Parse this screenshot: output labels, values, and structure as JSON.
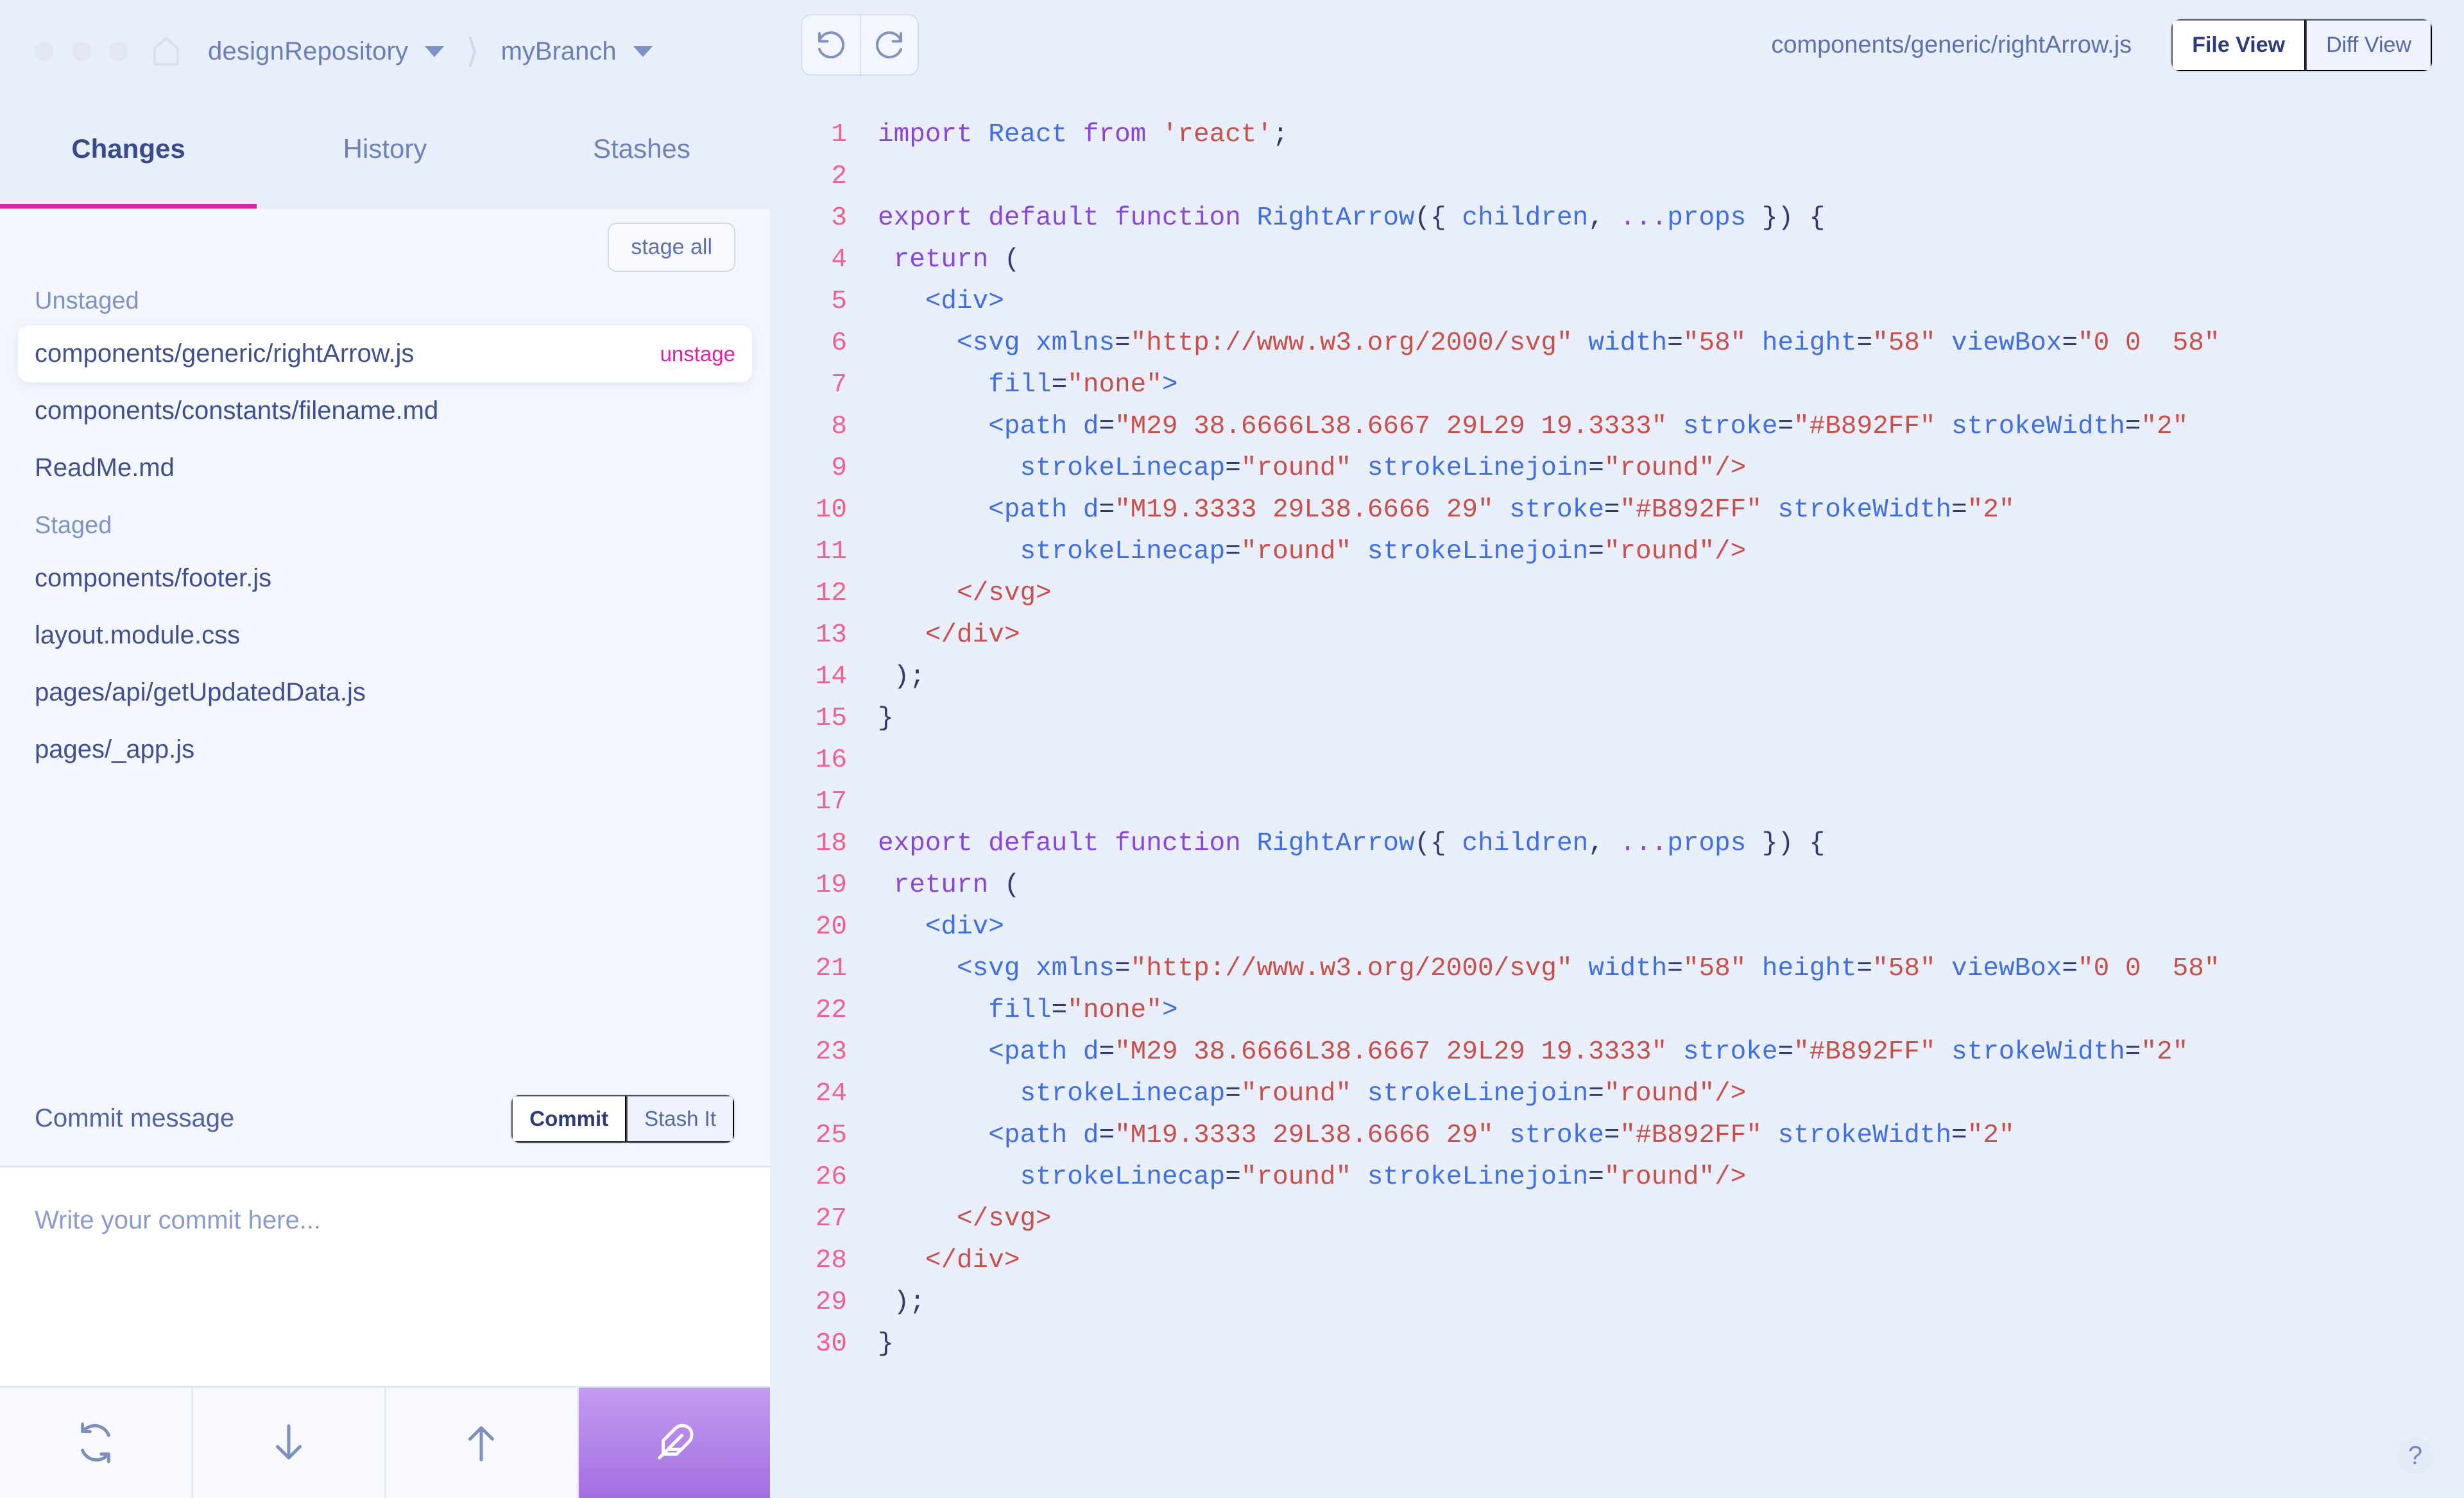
{
  "titlebar": {
    "home_icon": "home-icon",
    "repository": "designRepository",
    "branch": "myBranch",
    "separator": "⟩"
  },
  "tabs": [
    {
      "label": "Changes",
      "active": true
    },
    {
      "label": "History",
      "active": false
    },
    {
      "label": "Stashes",
      "active": false
    }
  ],
  "staging": {
    "stage_all_label": "stage all",
    "unstaged_label": "Unstaged",
    "staged_label": "Staged",
    "unstaged_files": [
      {
        "path": "components/generic/rightArrow.js",
        "action": "unstage",
        "selected": true
      },
      {
        "path": "components/constants/filename.md",
        "action": "",
        "selected": false
      },
      {
        "path": "ReadMe.md",
        "action": "",
        "selected": false
      }
    ],
    "staged_files": [
      {
        "path": "components/footer.js",
        "action": "",
        "selected": false
      },
      {
        "path": "layout.module.css",
        "action": "",
        "selected": false
      },
      {
        "path": "pages/api/getUpdatedData.js",
        "action": "",
        "selected": false
      },
      {
        "path": " pages/_app.js",
        "action": "",
        "selected": false
      }
    ]
  },
  "commit": {
    "header_label": "Commit message",
    "commit_button": "Commit",
    "stash_button": "Stash It",
    "placeholder": "Write your commit here..."
  },
  "bottom_toolbar": [
    {
      "icon": "sync-icon",
      "accent": false
    },
    {
      "icon": "arrow-down-icon",
      "accent": false
    },
    {
      "icon": "arrow-up-icon",
      "accent": false
    },
    {
      "icon": "feather-icon",
      "accent": true
    }
  ],
  "editor": {
    "undo_icon": "undo-icon",
    "redo_icon": "redo-icon",
    "current_file": "components/generic/rightArrow.js",
    "file_view_label": "File View",
    "diff_view_label": "Diff View",
    "active_view": "File View",
    "help_label": "?"
  },
  "colors": {
    "accent_magenta": "#e11fa8",
    "accent_purple": "#a36fe0",
    "line_number": "#f0618f",
    "keyword": "#8b46d6",
    "identifier": "#3f6fe0",
    "string": "#c9504a",
    "code_bg": "#e8eefa",
    "sidebar_bg": "#f4f6fe"
  },
  "code": [
    {
      "n": "1",
      "tokens": [
        {
          "t": "k",
          "v": "import"
        },
        {
          "t": "ctext",
          "v": " "
        },
        {
          "t": "fn",
          "v": "React"
        },
        {
          "t": "ctext",
          "v": " "
        },
        {
          "t": "k",
          "v": "from"
        },
        {
          "t": "ctext",
          "v": " "
        },
        {
          "t": "s",
          "v": "'react'"
        },
        {
          "t": "p",
          "v": ";"
        }
      ]
    },
    {
      "n": "2",
      "tokens": []
    },
    {
      "n": "3",
      "tokens": [
        {
          "t": "k",
          "v": "export default function "
        },
        {
          "t": "fn",
          "v": "RightArrow"
        },
        {
          "t": "p",
          "v": "({ "
        },
        {
          "t": "fn",
          "v": "children"
        },
        {
          "t": "p",
          "v": ", "
        },
        {
          "t": "k",
          "v": "..."
        },
        {
          "t": "fn",
          "v": "props"
        },
        {
          "t": "p",
          "v": " }) {"
        }
      ]
    },
    {
      "n": "4",
      "tokens": [
        {
          "t": "ctext",
          "v": " "
        },
        {
          "t": "k",
          "v": "return"
        },
        {
          "t": "p",
          "v": " ("
        }
      ]
    },
    {
      "n": "5",
      "tokens": [
        {
          "t": "ctext",
          "v": "   "
        },
        {
          "t": "tg",
          "v": "<div>"
        }
      ]
    },
    {
      "n": "6",
      "tokens": [
        {
          "t": "ctext",
          "v": "     "
        },
        {
          "t": "tg",
          "v": "<svg "
        },
        {
          "t": "fn",
          "v": "xmlns"
        },
        {
          "t": "p",
          "v": "="
        },
        {
          "t": "s",
          "v": "\"http://www.w3.org/2000/svg\""
        },
        {
          "t": "ctext",
          "v": " "
        },
        {
          "t": "fn",
          "v": "width"
        },
        {
          "t": "p",
          "v": "="
        },
        {
          "t": "s",
          "v": "\"58\""
        },
        {
          "t": "ctext",
          "v": " "
        },
        {
          "t": "fn",
          "v": "height"
        },
        {
          "t": "p",
          "v": "="
        },
        {
          "t": "s",
          "v": "\"58\""
        },
        {
          "t": "ctext",
          "v": " "
        },
        {
          "t": "fn",
          "v": "viewBox"
        },
        {
          "t": "p",
          "v": "="
        },
        {
          "t": "s",
          "v": "\"0 0  58\""
        }
      ]
    },
    {
      "n": "7",
      "tokens": [
        {
          "t": "ctext",
          "v": "       "
        },
        {
          "t": "fn",
          "v": "fill"
        },
        {
          "t": "p",
          "v": "="
        },
        {
          "t": "s",
          "v": "\"none\""
        },
        {
          "t": "tg",
          "v": ">"
        }
      ]
    },
    {
      "n": "8",
      "tokens": [
        {
          "t": "ctext",
          "v": "       "
        },
        {
          "t": "tg",
          "v": "<path "
        },
        {
          "t": "fn",
          "v": "d"
        },
        {
          "t": "p",
          "v": "="
        },
        {
          "t": "s",
          "v": "\"M29 38.6666L38.6667 29L29 19.3333\""
        },
        {
          "t": "ctext",
          "v": " "
        },
        {
          "t": "fn",
          "v": "stroke"
        },
        {
          "t": "p",
          "v": "="
        },
        {
          "t": "s",
          "v": "\"#B892FF\""
        },
        {
          "t": "ctext",
          "v": " "
        },
        {
          "t": "fn",
          "v": "strokeWidth"
        },
        {
          "t": "p",
          "v": "="
        },
        {
          "t": "s",
          "v": "\"2\""
        }
      ]
    },
    {
      "n": "9",
      "tokens": [
        {
          "t": "ctext",
          "v": "         "
        },
        {
          "t": "fn",
          "v": "strokeLinecap"
        },
        {
          "t": "p",
          "v": "="
        },
        {
          "t": "s",
          "v": "\"round\""
        },
        {
          "t": "ctext",
          "v": " "
        },
        {
          "t": "fn",
          "v": "strokeLinejoin"
        },
        {
          "t": "p",
          "v": "="
        },
        {
          "t": "s",
          "v": "\"round\""
        },
        {
          "t": "cl",
          "v": "/>"
        }
      ]
    },
    {
      "n": "10",
      "tokens": [
        {
          "t": "ctext",
          "v": "       "
        },
        {
          "t": "tg",
          "v": "<path "
        },
        {
          "t": "fn",
          "v": "d"
        },
        {
          "t": "p",
          "v": "="
        },
        {
          "t": "s",
          "v": "\"M19.3333 29L38.6666 29\""
        },
        {
          "t": "ctext",
          "v": " "
        },
        {
          "t": "fn",
          "v": "stroke"
        },
        {
          "t": "p",
          "v": "="
        },
        {
          "t": "s",
          "v": "\"#B892FF\""
        },
        {
          "t": "ctext",
          "v": " "
        },
        {
          "t": "fn",
          "v": "strokeWidth"
        },
        {
          "t": "p",
          "v": "="
        },
        {
          "t": "s",
          "v": "\"2\""
        }
      ]
    },
    {
      "n": "11",
      "tokens": [
        {
          "t": "ctext",
          "v": "         "
        },
        {
          "t": "fn",
          "v": "strokeLinecap"
        },
        {
          "t": "p",
          "v": "="
        },
        {
          "t": "s",
          "v": "\"round\""
        },
        {
          "t": "ctext",
          "v": " "
        },
        {
          "t": "fn",
          "v": "strokeLinejoin"
        },
        {
          "t": "p",
          "v": "="
        },
        {
          "t": "s",
          "v": "\"round\""
        },
        {
          "t": "cl",
          "v": "/>"
        }
      ]
    },
    {
      "n": "12",
      "tokens": [
        {
          "t": "ctext",
          "v": "     "
        },
        {
          "t": "cl",
          "v": "</svg>"
        }
      ]
    },
    {
      "n": "13",
      "tokens": [
        {
          "t": "ctext",
          "v": "   "
        },
        {
          "t": "cl",
          "v": "</div>"
        }
      ]
    },
    {
      "n": "14",
      "tokens": [
        {
          "t": "ctext",
          "v": " "
        },
        {
          "t": "p",
          "v": ");"
        }
      ]
    },
    {
      "n": "15",
      "tokens": [
        {
          "t": "p",
          "v": "}"
        }
      ]
    },
    {
      "n": "16",
      "tokens": []
    },
    {
      "n": "17",
      "tokens": []
    },
    {
      "n": "18",
      "tokens": [
        {
          "t": "k",
          "v": "export default function "
        },
        {
          "t": "fn",
          "v": "RightArrow"
        },
        {
          "t": "p",
          "v": "({ "
        },
        {
          "t": "fn",
          "v": "children"
        },
        {
          "t": "p",
          "v": ", "
        },
        {
          "t": "k",
          "v": "..."
        },
        {
          "t": "fn",
          "v": "props"
        },
        {
          "t": "p",
          "v": " }) {"
        }
      ]
    },
    {
      "n": "19",
      "tokens": [
        {
          "t": "ctext",
          "v": " "
        },
        {
          "t": "k",
          "v": "return"
        },
        {
          "t": "p",
          "v": " ("
        }
      ]
    },
    {
      "n": "20",
      "tokens": [
        {
          "t": "ctext",
          "v": "   "
        },
        {
          "t": "tg",
          "v": "<div>"
        }
      ]
    },
    {
      "n": "21",
      "tokens": [
        {
          "t": "ctext",
          "v": "     "
        },
        {
          "t": "tg",
          "v": "<svg "
        },
        {
          "t": "fn",
          "v": "xmlns"
        },
        {
          "t": "p",
          "v": "="
        },
        {
          "t": "s",
          "v": "\"http://www.w3.org/2000/svg\""
        },
        {
          "t": "ctext",
          "v": " "
        },
        {
          "t": "fn",
          "v": "width"
        },
        {
          "t": "p",
          "v": "="
        },
        {
          "t": "s",
          "v": "\"58\""
        },
        {
          "t": "ctext",
          "v": " "
        },
        {
          "t": "fn",
          "v": "height"
        },
        {
          "t": "p",
          "v": "="
        },
        {
          "t": "s",
          "v": "\"58\""
        },
        {
          "t": "ctext",
          "v": " "
        },
        {
          "t": "fn",
          "v": "viewBox"
        },
        {
          "t": "p",
          "v": "="
        },
        {
          "t": "s",
          "v": "\"0 0  58\""
        }
      ]
    },
    {
      "n": "22",
      "tokens": [
        {
          "t": "ctext",
          "v": "       "
        },
        {
          "t": "fn",
          "v": "fill"
        },
        {
          "t": "p",
          "v": "="
        },
        {
          "t": "s",
          "v": "\"none\""
        },
        {
          "t": "tg",
          "v": ">"
        }
      ]
    },
    {
      "n": "23",
      "tokens": [
        {
          "t": "ctext",
          "v": "       "
        },
        {
          "t": "tg",
          "v": "<path "
        },
        {
          "t": "fn",
          "v": "d"
        },
        {
          "t": "p",
          "v": "="
        },
        {
          "t": "s",
          "v": "\"M29 38.6666L38.6667 29L29 19.3333\""
        },
        {
          "t": "ctext",
          "v": " "
        },
        {
          "t": "fn",
          "v": "stroke"
        },
        {
          "t": "p",
          "v": "="
        },
        {
          "t": "s",
          "v": "\"#B892FF\""
        },
        {
          "t": "ctext",
          "v": " "
        },
        {
          "t": "fn",
          "v": "strokeWidth"
        },
        {
          "t": "p",
          "v": "="
        },
        {
          "t": "s",
          "v": "\"2\""
        }
      ]
    },
    {
      "n": "24",
      "tokens": [
        {
          "t": "ctext",
          "v": "         "
        },
        {
          "t": "fn",
          "v": "strokeLinecap"
        },
        {
          "t": "p",
          "v": "="
        },
        {
          "t": "s",
          "v": "\"round\""
        },
        {
          "t": "ctext",
          "v": " "
        },
        {
          "t": "fn",
          "v": "strokeLinejoin"
        },
        {
          "t": "p",
          "v": "="
        },
        {
          "t": "s",
          "v": "\"round\""
        },
        {
          "t": "cl",
          "v": "/>"
        }
      ]
    },
    {
      "n": "25",
      "tokens": [
        {
          "t": "ctext",
          "v": "       "
        },
        {
          "t": "tg",
          "v": "<path "
        },
        {
          "t": "fn",
          "v": "d"
        },
        {
          "t": "p",
          "v": "="
        },
        {
          "t": "s",
          "v": "\"M19.3333 29L38.6666 29\""
        },
        {
          "t": "ctext",
          "v": " "
        },
        {
          "t": "fn",
          "v": "stroke"
        },
        {
          "t": "p",
          "v": "="
        },
        {
          "t": "s",
          "v": "\"#B892FF\""
        },
        {
          "t": "ctext",
          "v": " "
        },
        {
          "t": "fn",
          "v": "strokeWidth"
        },
        {
          "t": "p",
          "v": "="
        },
        {
          "t": "s",
          "v": "\"2\""
        }
      ]
    },
    {
      "n": "26",
      "tokens": [
        {
          "t": "ctext",
          "v": "         "
        },
        {
          "t": "fn",
          "v": "strokeLinecap"
        },
        {
          "t": "p",
          "v": "="
        },
        {
          "t": "s",
          "v": "\"round\""
        },
        {
          "t": "ctext",
          "v": " "
        },
        {
          "t": "fn",
          "v": "strokeLinejoin"
        },
        {
          "t": "p",
          "v": "="
        },
        {
          "t": "s",
          "v": "\"round\""
        },
        {
          "t": "cl",
          "v": "/>"
        }
      ]
    },
    {
      "n": "27",
      "tokens": [
        {
          "t": "ctext",
          "v": "     "
        },
        {
          "t": "cl",
          "v": "</svg>"
        }
      ]
    },
    {
      "n": "28",
      "tokens": [
        {
          "t": "ctext",
          "v": "   "
        },
        {
          "t": "cl",
          "v": "</div>"
        }
      ]
    },
    {
      "n": "29",
      "tokens": [
        {
          "t": "ctext",
          "v": " "
        },
        {
          "t": "p",
          "v": ");"
        }
      ]
    },
    {
      "n": "30",
      "tokens": [
        {
          "t": "p",
          "v": "}"
        }
      ]
    }
  ]
}
